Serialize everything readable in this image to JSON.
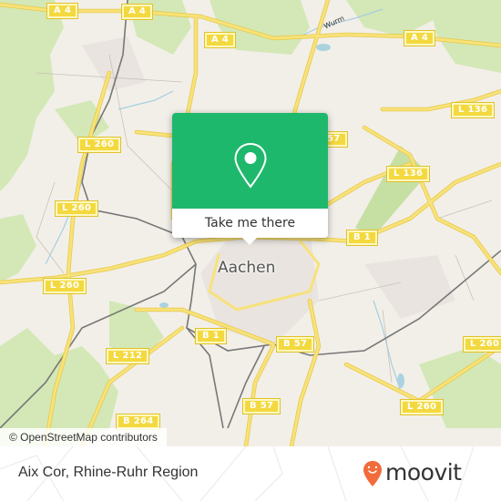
{
  "map": {
    "city_label": "Aachen",
    "river_label": "Wurm",
    "road_shields": [
      {
        "label": "A 4"
      },
      {
        "label": "A 4"
      },
      {
        "label": "A 4"
      },
      {
        "label": "A 4"
      },
      {
        "label": "L 136"
      },
      {
        "label": "L 136"
      },
      {
        "label": "L 260"
      },
      {
        "label": "L 260"
      },
      {
        "label": "L 260"
      },
      {
        "label": "L 260"
      },
      {
        "label": "L 260"
      },
      {
        "label": "L 212"
      },
      {
        "label": "B 1"
      },
      {
        "label": "B 1"
      },
      {
        "label": "B 57"
      },
      {
        "label": "B 57"
      },
      {
        "label": "B 264"
      },
      {
        "label": "57"
      }
    ],
    "attribution": "© OpenStreetMap contributors",
    "colors": {
      "land": "#f2efe9",
      "forest": "#cfe6b0",
      "road": "#f6dc5a",
      "water": "#aad3df"
    }
  },
  "popup": {
    "icon": "map-pin-icon",
    "button_label": "Take me there",
    "color": "#1eb86c"
  },
  "footer": {
    "place_name": "Aix Cor, Rhine-Ruhr Region",
    "brand": "moovit",
    "brand_icon": "moovit-pin-smile-icon",
    "brand_color": "#f26b3a"
  }
}
